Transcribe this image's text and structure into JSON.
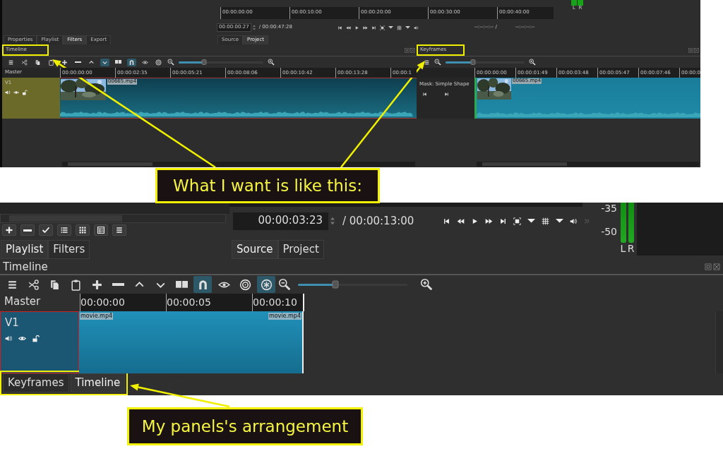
{
  "top_screenshot": {
    "player": {
      "ruler_labels": [
        "00:00:00:00",
        "00:00:10:00",
        "00:00:20:00",
        "00:00:30:00",
        "00:00:40:00"
      ],
      "timecode": "00:00:00:27",
      "duration": "/ 00:00:47:28",
      "in_point": "--:--:--:-- /",
      "out_point": "--:--:--:--",
      "meter_channels": [
        "L",
        "R"
      ]
    },
    "left_tabs": [
      {
        "label": "Properties",
        "selected": false
      },
      {
        "label": "Playlist",
        "selected": false
      },
      {
        "label": "Filters",
        "selected": true
      },
      {
        "label": "Export",
        "selected": false
      }
    ],
    "player_tabs": [
      {
        "label": "Source",
        "selected": false
      },
      {
        "label": "Project",
        "selected": true
      }
    ],
    "timeline": {
      "title": "Timeline",
      "highlighted": true,
      "toolbar": [
        {
          "kind": "menu",
          "active": false
        },
        {
          "kind": "cut",
          "active": false
        },
        {
          "kind": "copy",
          "active": false
        },
        {
          "kind": "paste",
          "active": false
        },
        {
          "kind": "add",
          "active": false
        },
        {
          "kind": "remove",
          "active": false
        },
        {
          "kind": "up",
          "active": false
        },
        {
          "kind": "down",
          "active": true
        },
        {
          "kind": "split",
          "active": false
        },
        {
          "kind": "snap",
          "active": true
        },
        {
          "kind": "ripple",
          "active": false
        },
        {
          "kind": "center",
          "active": false
        }
      ],
      "zoom": {
        "level": 0.3
      },
      "master_label": "Master",
      "ruler_labels": [
        "00:00:00:00",
        "00:00:02:35",
        "00:00:05:21",
        "00:00:08:06",
        "00:00:10:42",
        "00:00:13:28",
        "00:00:1"
      ],
      "tracks": [
        {
          "name": "V1",
          "clips": [
            {
              "label": "00665.mp4"
            }
          ]
        }
      ]
    },
    "keyframes": {
      "title": "Keyframes",
      "highlighted": true,
      "zoom": {
        "level": 0.35
      },
      "filter_name": "Mask: Simple Shape",
      "ruler_labels": [
        "00:00:00:00",
        "00:00:01:49",
        "00:00:03:48",
        "00:00:05:47",
        "00:00:07:46",
        "00:00:0"
      ],
      "clip_label": "00665.mp4"
    }
  },
  "callout_top": {
    "text": "What I want is like this:"
  },
  "bottom_screenshot": {
    "playlist_buttons": [
      {
        "kind": "add"
      },
      {
        "kind": "remove"
      },
      {
        "kind": "check"
      },
      {
        "kind": "list"
      },
      {
        "kind": "tiles"
      },
      {
        "kind": "details"
      },
      {
        "kind": "menu"
      }
    ],
    "left_tabs": [
      {
        "label": "Playlist",
        "selected": true
      },
      {
        "label": "Filters",
        "selected": false
      }
    ],
    "player": {
      "timecode": "00:00:03:23",
      "duration": "/ 00:00:13:00",
      "overflow": "»",
      "meter_labels": [
        "-35",
        "-50"
      ],
      "meter_channels": [
        "L",
        "R"
      ]
    },
    "player_tabs": [
      {
        "label": "Source",
        "selected": true
      },
      {
        "label": "Project",
        "selected": false
      }
    ],
    "timeline": {
      "title": "Timeline",
      "toolbar": [
        {
          "kind": "menu",
          "active": false
        },
        {
          "kind": "cut",
          "active": false
        },
        {
          "kind": "copy",
          "active": false
        },
        {
          "kind": "paste",
          "active": false
        },
        {
          "kind": "add",
          "active": false
        },
        {
          "kind": "remove",
          "active": false
        },
        {
          "kind": "up",
          "active": false
        },
        {
          "kind": "down",
          "active": false
        },
        {
          "kind": "split",
          "active": false
        },
        {
          "kind": "snap",
          "active": true
        },
        {
          "kind": "ripple",
          "active": false
        },
        {
          "kind": "center",
          "active": false
        },
        {
          "kind": "ripple-all",
          "active": true
        }
      ],
      "zoom": {
        "level": 0.34
      },
      "master_label": "Master",
      "ruler_labels": [
        "00:00:00",
        "00:00:05",
        "00:00:10"
      ],
      "tracks": [
        {
          "name": "V1",
          "clips": [
            {
              "start_label": "movie.mp4",
              "end_label": "movie.mp4"
            }
          ]
        }
      ]
    },
    "dock_tabs_highlighted": true,
    "dock_tabs": [
      {
        "label": "Keyframes",
        "selected": false
      },
      {
        "label": "Timeline",
        "selected": true
      }
    ]
  },
  "callout_bottom": {
    "text": "My panels's arrangement"
  }
}
